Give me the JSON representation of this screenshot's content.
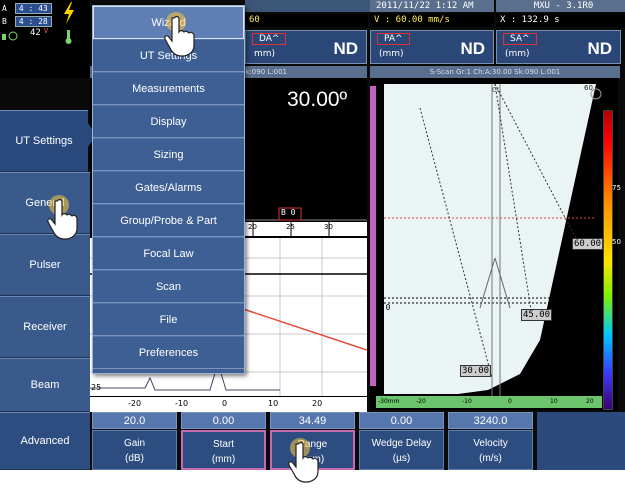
{
  "status": {
    "battery_a_label": "A",
    "battery_a_time": "4 : 43",
    "battery_b_label": "B",
    "battery_b_time": "4 : 28",
    "temp": "42",
    "temp_unit": "V",
    "icon_names": [
      "lightning-icon",
      "battery-icon",
      "wireless-icon",
      "thermometer-icon"
    ]
  },
  "header": {
    "datetime": "2011/11/22 1:12 AM",
    "model": "MXU - 3.1R0",
    "left_value": "60",
    "velocity_readout": "V : 60.00 mm/s",
    "position_readout": "X : 132.9 s"
  },
  "readouts": [
    {
      "label": "DA^",
      "unit": "mm)",
      "value": "ND"
    },
    {
      "label": "PA^",
      "unit": "(mm)",
      "value": "ND"
    },
    {
      "label": "SA^",
      "unit": "(mm)",
      "value": "ND"
    }
  ],
  "subheaders": {
    "left": "Sk:090 L:001",
    "right": "S-Scan Gr:1 Ch:A:30.00 Sk:090 L:001"
  },
  "sidebar": {
    "items": [
      {
        "label": "UT Settings",
        "active": true
      },
      {
        "label": "General"
      },
      {
        "label": "Pulser"
      },
      {
        "label": "Receiver"
      },
      {
        "label": "Beam"
      },
      {
        "label": "Advanced"
      }
    ]
  },
  "menu": {
    "items": [
      {
        "label": "Wizard",
        "selected": true
      },
      {
        "label": "UT Settings"
      },
      {
        "label": "Measurements"
      },
      {
        "label": "Display"
      },
      {
        "label": "Sizing"
      },
      {
        "label": "Gates/Alarms"
      },
      {
        "label": "Group/Probe & Part"
      },
      {
        "label": "Focal Law"
      },
      {
        "label": "Scan"
      },
      {
        "label": "File"
      },
      {
        "label": "Preferences"
      }
    ]
  },
  "ascan": {
    "angle": "30.00º",
    "gate_label": "B 0",
    "ruler_top": [
      "20",
      "25",
      "30"
    ],
    "ruler_bottom": [
      "-20",
      "-10",
      "0",
      "10",
      "20"
    ],
    "left_tick": "25"
  },
  "sscan": {
    "angle_marker": "60",
    "label_60": "60.00",
    "label_45": "45.00",
    "label_30": "30.00",
    "gate_label": "B 0",
    "cl_label": "CL",
    "bottom_ticks": [
      "-30mm",
      "-20",
      "-10",
      "0",
      "10",
      "20"
    ],
    "palette_marks": [
      "75",
      "50"
    ]
  },
  "params": [
    {
      "value": "20.0",
      "label": "Gain",
      "unit": "(dB)"
    },
    {
      "value": "0.00",
      "label": "Start",
      "unit": "(mm)"
    },
    {
      "value": "34.49",
      "label": "Range",
      "unit": "(mm)"
    },
    {
      "value": "0.00",
      "label": "Wedge Delay",
      "unit": "(µs)"
    },
    {
      "value": "3240.0",
      "label": "Velocity",
      "unit": "(m/s)"
    }
  ]
}
